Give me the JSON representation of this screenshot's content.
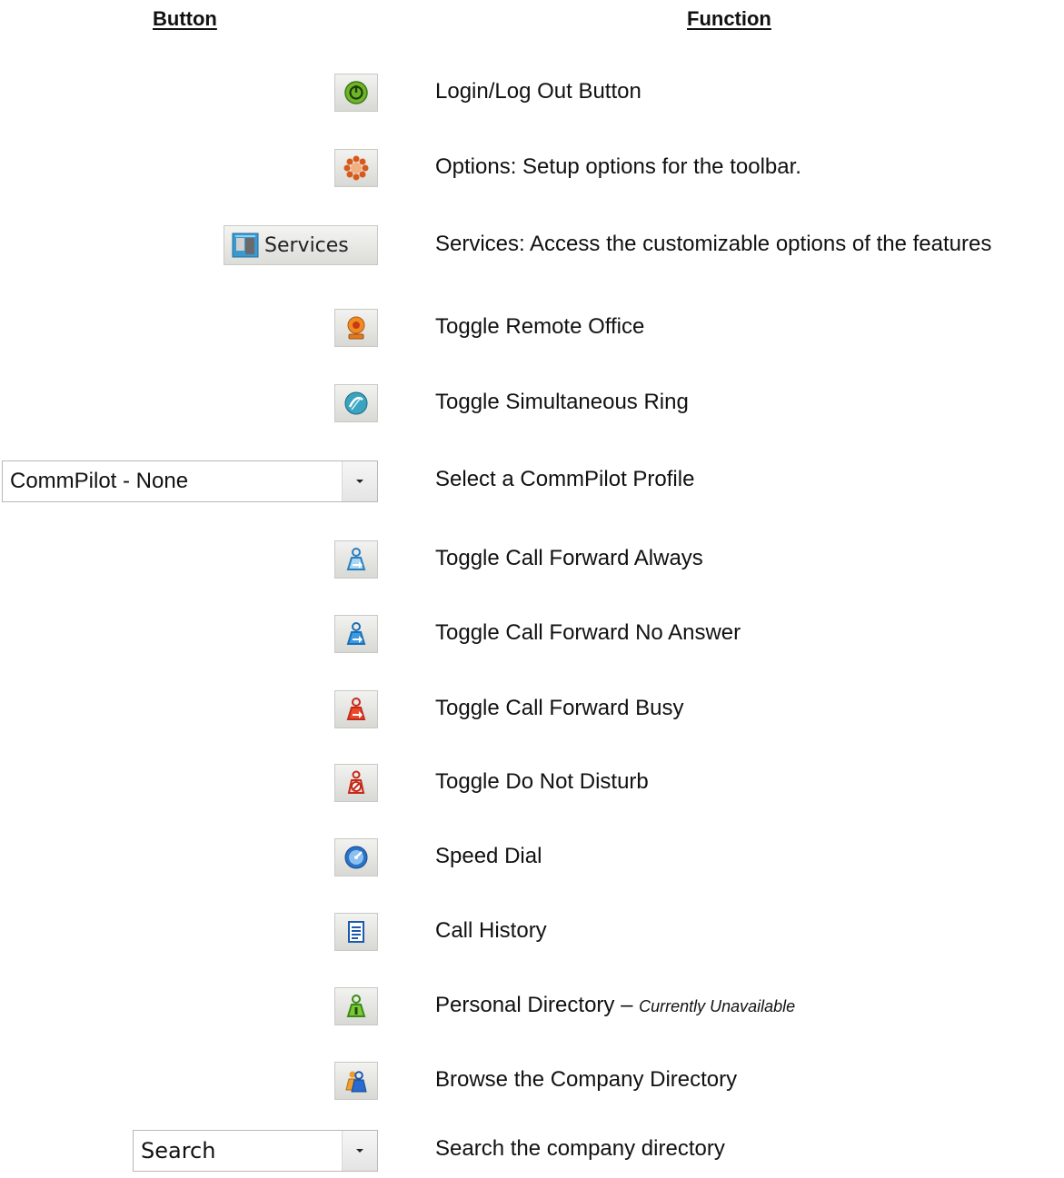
{
  "headers": {
    "button": "Button",
    "function": "Function"
  },
  "rows": [
    {
      "icon": "power-icon",
      "function": "Login/Log Out Button"
    },
    {
      "icon": "gear-icon",
      "function": "Options:  Setup options for the toolbar."
    },
    {
      "button_label": "Services",
      "icon": "services-icon",
      "function": "Services:  Access the customizable options of the features"
    },
    {
      "icon": "remote-office-icon",
      "function": "Toggle Remote Office"
    },
    {
      "icon": "simultaneous-ring-icon",
      "function": "Toggle Simultaneous Ring"
    },
    {
      "select_value": "CommPilot - None",
      "function": "Select a CommPilot Profile"
    },
    {
      "icon": "call-forward-always-icon",
      "function": "Toggle Call Forward Always"
    },
    {
      "icon": "call-forward-no-answer-icon",
      "function": "Toggle Call Forward No Answer"
    },
    {
      "icon": "call-forward-busy-icon",
      "function": "Toggle Call Forward Busy"
    },
    {
      "icon": "do-not-disturb-icon",
      "function": "Toggle Do Not Disturb"
    },
    {
      "icon": "speed-dial-icon",
      "function": "Speed Dial"
    },
    {
      "icon": "call-history-icon",
      "function": "Call History"
    },
    {
      "icon": "personal-directory-icon",
      "function": "Personal Directory – ",
      "note": "Currently Unavailable"
    },
    {
      "icon": "company-directory-icon",
      "function": "Browse the Company Directory"
    },
    {
      "select_value": "Search",
      "function": "Search the company directory"
    }
  ]
}
